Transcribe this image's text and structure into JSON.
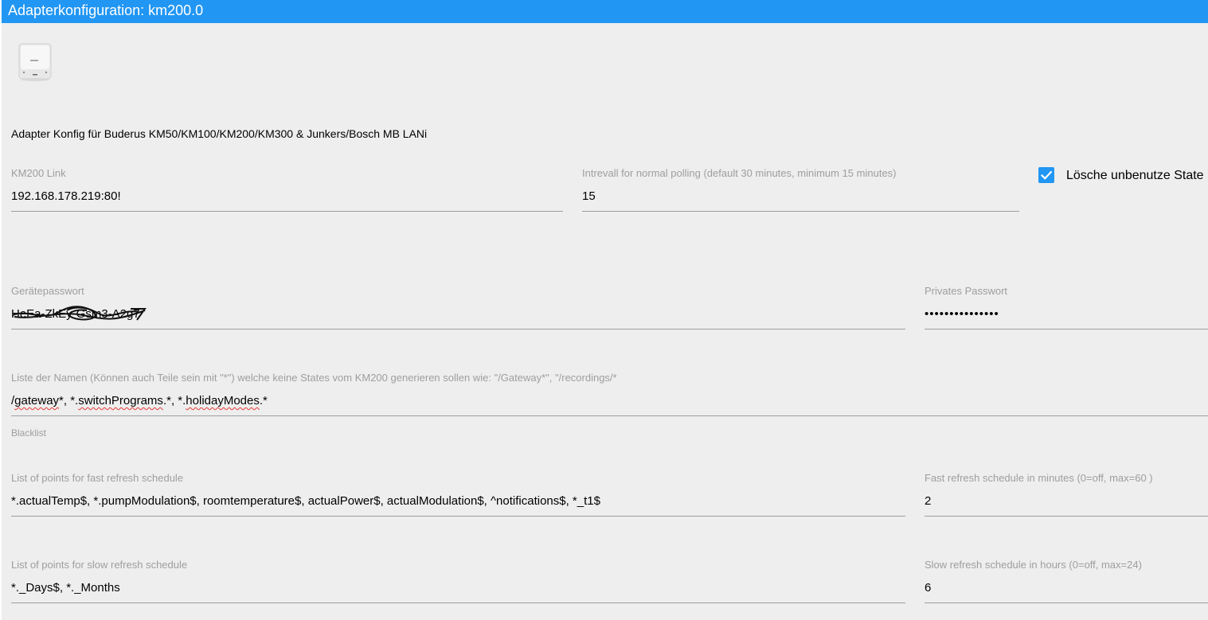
{
  "window": {
    "title": "Adapterkonfiguration: km200.0"
  },
  "adapter": {
    "logo_icon": "km200-device-icon",
    "description": "Adapter Konfig für Buderus KM50/KM100/KM200/KM300 & Junkers/Bosch MB LANi"
  },
  "fields": {
    "km200_link": {
      "label": "KM200 Link",
      "value": "192.168.178.219:80!"
    },
    "polling_interval": {
      "label": "Intrevall for normal polling (default 30 minutes, minimum 15 minutes)",
      "value": "15"
    },
    "delete_unused_states": {
      "label": "Lösche unbenutze State",
      "checked": true
    },
    "device_password": {
      "label": "Gerätepasswort",
      "value": "HeEa-ZkEy-Gsm3-A2g7",
      "redacted": true
    },
    "private_password": {
      "label": "Privates Passwort",
      "value": "•••••••••••••••"
    },
    "blacklist": {
      "label": "Liste der Namen (Können auch Teile sein mit \"*\") welche keine States vom KM200 generieren sollen wie: \"/Gateway*\", \"/recordings/*",
      "value_parts": [
        "/",
        "gateway",
        "*, *.",
        "switchPrograms",
        ".*, *.",
        "holidayModes",
        ".*"
      ],
      "helper": "Blacklist"
    },
    "fast_refresh_points": {
      "label": "List of points for fast refresh schedule",
      "value": "*.actualTemp$, *.pumpModulation$, roomtemperature$, actualPower$, actualModulation$, ^notifications$, *_t1$"
    },
    "fast_refresh_minutes": {
      "label": "Fast refresh schedule in minutes (0=off, max=60 )",
      "value": "2"
    },
    "slow_refresh_points": {
      "label": "List of points for slow refresh schedule",
      "value": "*._Days$, *._Months"
    },
    "slow_refresh_hours": {
      "label": "Slow refresh schedule in hours (0=off, max=24)",
      "value": "6"
    }
  },
  "colors": {
    "accent": "#2196f3",
    "background": "#eeeeee",
    "label": "#9e9e9e",
    "spellcheck": "#e53935"
  }
}
